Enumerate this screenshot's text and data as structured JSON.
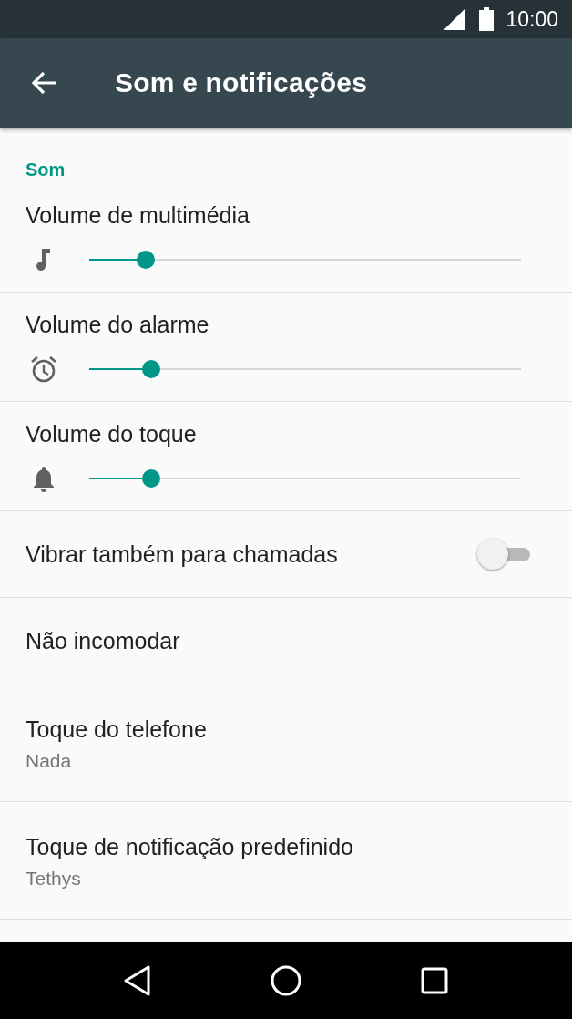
{
  "status_bar": {
    "time": "10:00"
  },
  "app_bar": {
    "title": "Som e notificações"
  },
  "section": {
    "header": "Som",
    "items": [
      {
        "kind": "slider",
        "title": "Volume de multimédia",
        "level": 0.13
      },
      {
        "kind": "slider",
        "title": "Volume do alarme",
        "level": 0.143
      },
      {
        "kind": "slider",
        "title": "Volume do toque",
        "level": 0.143
      },
      {
        "kind": "switch",
        "title": "Vibrar também para chamadas",
        "on": false
      },
      {
        "kind": "plain",
        "title": "Não incomodar"
      },
      {
        "kind": "summary",
        "title": "Toque do telefone",
        "summary": "Nada"
      },
      {
        "kind": "summary",
        "title": "Toque de notificação predefinido",
        "summary": "Tethys"
      }
    ]
  }
}
